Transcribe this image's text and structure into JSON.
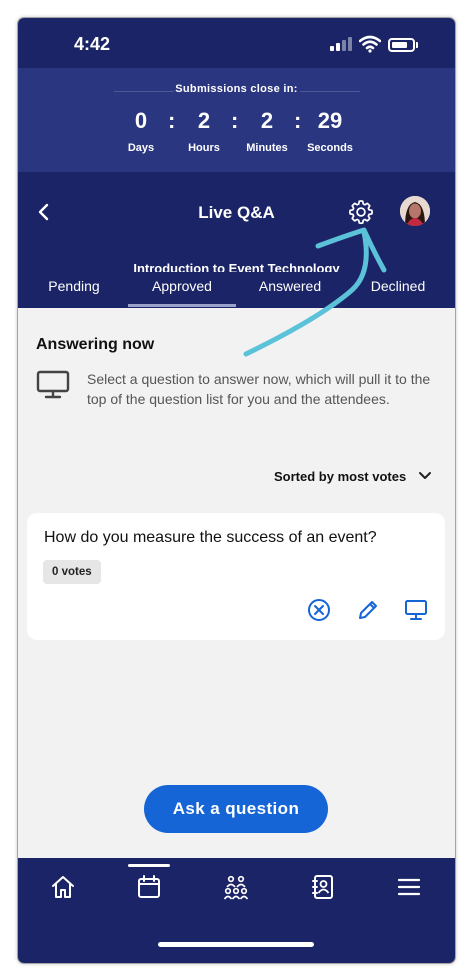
{
  "status_bar": {
    "time": "4:42"
  },
  "countdown": {
    "title": "Submissions close in:",
    "units": [
      {
        "value": "0",
        "label": "Days"
      },
      {
        "value": "2",
        "label": "Hours"
      },
      {
        "value": "2",
        "label": "Minutes"
      },
      {
        "value": "29",
        "label": "Seconds"
      }
    ],
    "separator": ":"
  },
  "header": {
    "title": "Live Q&A",
    "subtitle": "Introduction to Event Technology"
  },
  "tabs": [
    {
      "label": "Pending"
    },
    {
      "label": "Approved",
      "active": true
    },
    {
      "label": "Answered"
    },
    {
      "label": "Declined"
    }
  ],
  "answering_now": {
    "title": "Answering now",
    "description": "Select a question to answer now, which will pull it to the top of the question list for you and the attendees."
  },
  "sort": {
    "label": "Sorted by most votes"
  },
  "questions": [
    {
      "text": "How do you measure the success of an event?",
      "votes": "0 votes"
    }
  ],
  "ask_button": {
    "label": "Ask a question"
  },
  "bottom_nav": [
    "home-icon",
    "calendar-icon",
    "people-icon",
    "contacts-icon",
    "menu-icon"
  ],
  "colors": {
    "primary_navy": "#1b2466",
    "countdown_bg": "#2a3680",
    "action_blue": "#1565d6",
    "annotation_teal": "#5cc2d9"
  }
}
